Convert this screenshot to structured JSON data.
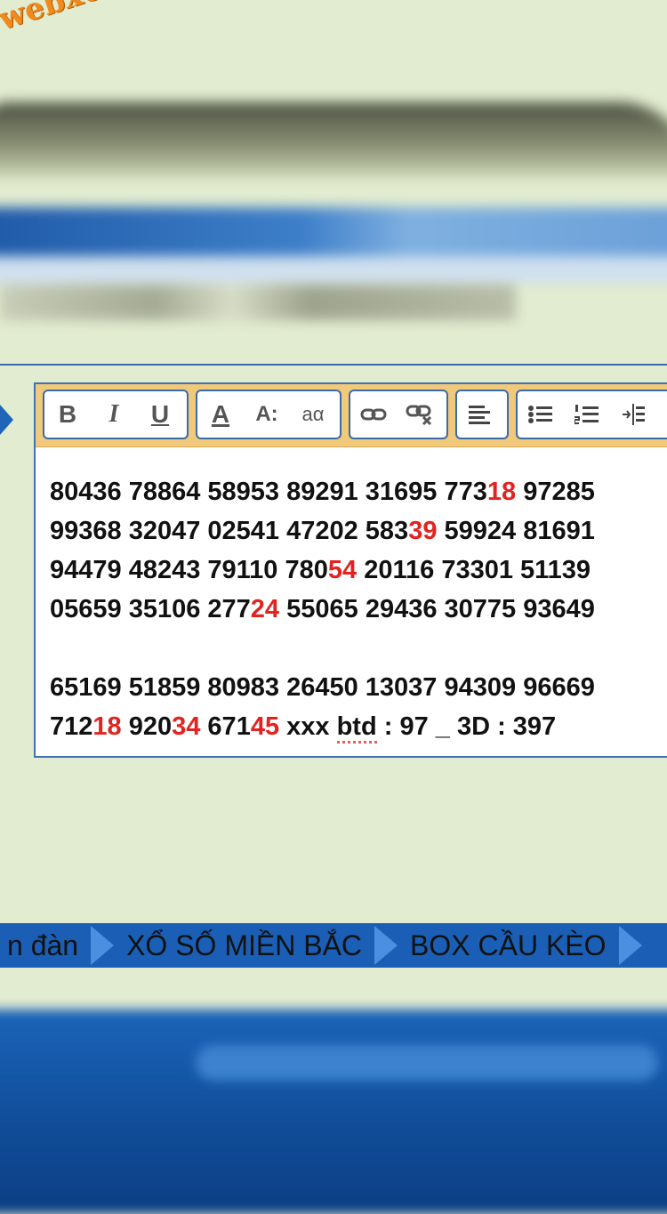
{
  "brand": {
    "logo_text": "webxoso.net"
  },
  "toolbar": {
    "bold_label": "B",
    "italic_label": "I",
    "underline_label": "U",
    "font_color_label": "A",
    "font_size_label": "A:",
    "case_label": "aα"
  },
  "editor": {
    "lines": [
      [
        {
          "t": "80436 78864 58953 89291 31695 773"
        },
        {
          "t": "18",
          "red": true
        },
        {
          "t": " 97285"
        }
      ],
      [
        {
          "t": "99368 32047 02541 47202 583"
        },
        {
          "t": "39",
          "red": true
        },
        {
          "t": " 59924 81691"
        }
      ],
      [
        {
          "t": "94479 48243 79110 780"
        },
        {
          "t": "54",
          "red": true
        },
        {
          "t": " 20116 73301 51139"
        }
      ],
      [
        {
          "t": "05659 35106 277"
        },
        {
          "t": "24",
          "red": true
        },
        {
          "t": " 55065 29436 30775 93649"
        }
      ],
      [],
      [
        {
          "t": "65169 51859 80983 26450 13037 94309 96669"
        }
      ],
      [
        {
          "t": "712"
        },
        {
          "t": "18",
          "red": true
        },
        {
          "t": " 920"
        },
        {
          "t": "34",
          "red": true
        },
        {
          "t": " 671"
        },
        {
          "t": "45",
          "red": true
        },
        {
          "t": " xxx "
        },
        {
          "t": "btd",
          "spell": true
        },
        {
          "t": " : 97 _ 3D : 397"
        }
      ]
    ]
  },
  "nav": {
    "items": [
      "n đàn",
      "XỔ SỐ MIỀN BẮC",
      "BOX CẦU KÈO"
    ]
  },
  "colors": {
    "highlight_red": "#e3231f",
    "toolbar_bg": "#f1c97a",
    "nav_bg": "#1a5fb5",
    "page_bg": "#e2ecd0"
  }
}
